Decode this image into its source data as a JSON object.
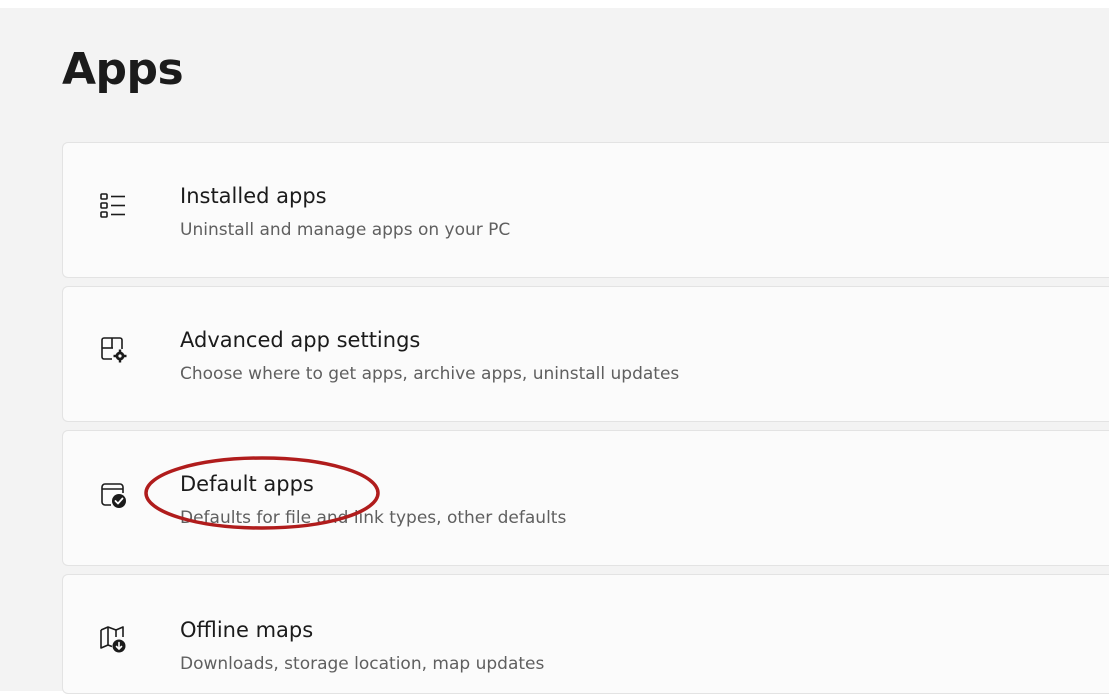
{
  "page": {
    "title": "Apps"
  },
  "items": [
    {
      "icon": "list-icon",
      "title": "Installed apps",
      "subtitle": "Uninstall and manage apps on your PC"
    },
    {
      "icon": "app-settings-icon",
      "title": "Advanced app settings",
      "subtitle": "Choose where to get apps, archive apps, uninstall updates"
    },
    {
      "icon": "default-apps-icon",
      "title": "Default apps",
      "subtitle": "Defaults for file and link types, other defaults"
    },
    {
      "icon": "offline-maps-icon",
      "title": "Offline maps",
      "subtitle": "Downloads, storage location, map updates"
    }
  ],
  "annotation": {
    "color": "#b01c1c"
  }
}
